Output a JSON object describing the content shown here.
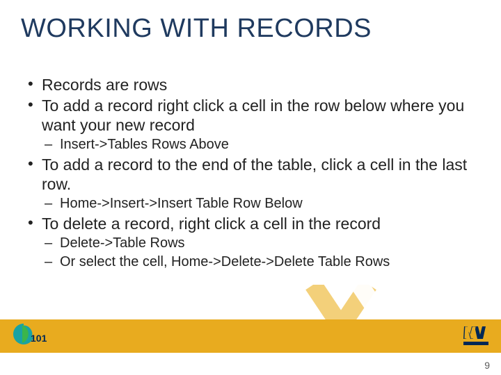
{
  "title": "WORKING WITH RECORDS",
  "bullets": {
    "b1": "Records are rows",
    "b2": "To add a record right click a cell in the row below where you want your new record",
    "b2a": "Insert->Tables Rows Above",
    "b3": "To add a record to the end of the table, click a cell in the last row.",
    "b3a": "Home->Insert->Insert Table Row Below",
    "b4": "To delete a record, right click a cell in the record",
    "b4a": "Delete->Table Rows",
    "b4b": "Or select the cell, Home->Delete->Delete Table Rows"
  },
  "page_number": "9",
  "colors": {
    "title": "#1f3a5f",
    "footer": "#e8ab1f",
    "wvu_navy": "#002855",
    "wvu_gold": "#e8ab1f"
  }
}
